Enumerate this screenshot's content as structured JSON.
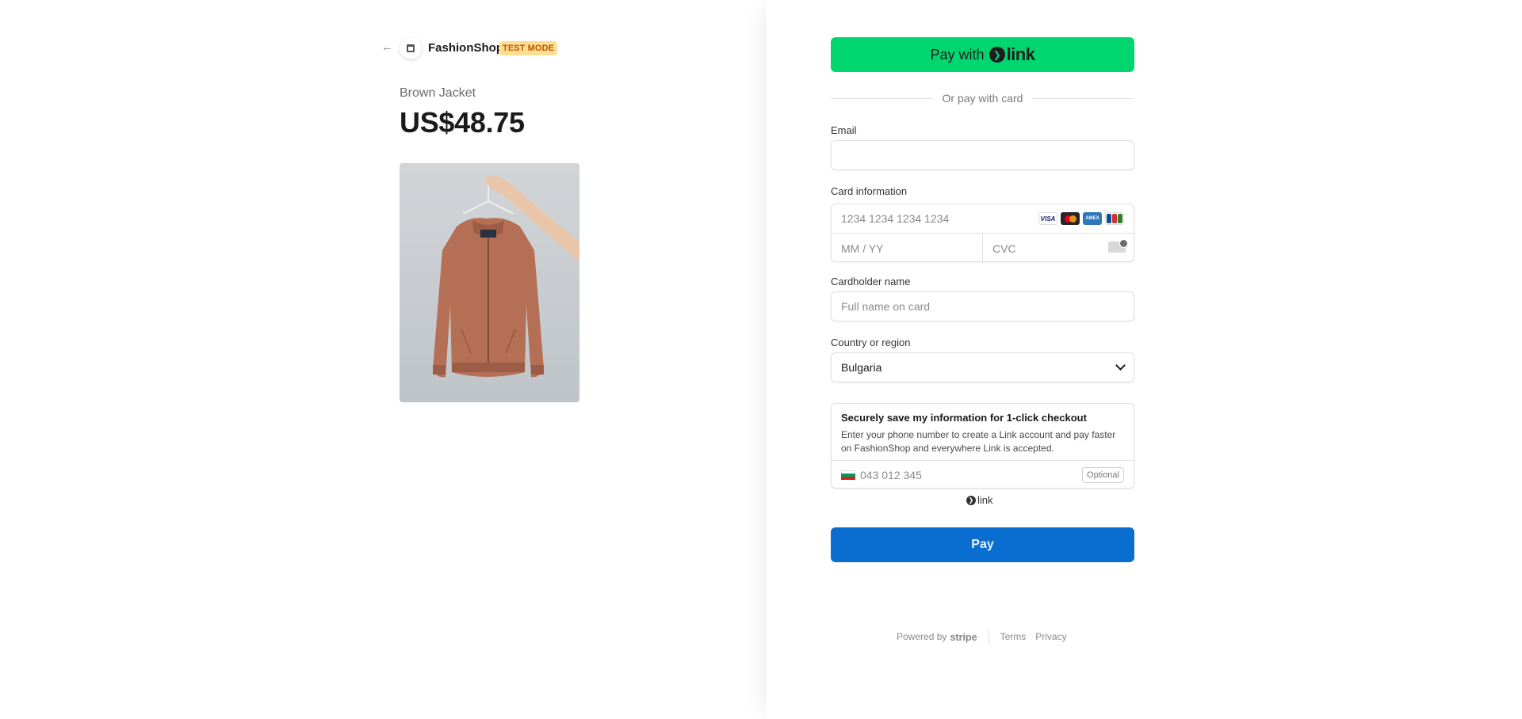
{
  "merchant": {
    "name": "FashionShop",
    "badge": "TEST MODE"
  },
  "product": {
    "name": "Brown Jacket",
    "price": "US$48.75"
  },
  "form": {
    "link_button_prefix": "Pay with",
    "link_logo_text": "link",
    "divider_text": "Or pay with card",
    "email": {
      "label": "Email",
      "value": ""
    },
    "card": {
      "label": "Card information",
      "number_placeholder": "1234 1234 1234 1234",
      "expiry_placeholder": "MM / YY",
      "cvc_placeholder": "CVC",
      "brands": [
        "VISA",
        "MasterCard",
        "AMEX",
        "JCB"
      ]
    },
    "cardholder": {
      "label": "Cardholder name",
      "placeholder": "Full name on card"
    },
    "country": {
      "label": "Country or region",
      "value": "Bulgaria"
    },
    "save": {
      "title": "Securely save my information for 1-click checkout",
      "description": "Enter your phone number to create a Link account and pay faster on FashionShop and everywhere Link is accepted.",
      "phone_placeholder": "043 012 345",
      "optional": "Optional"
    },
    "link_small": "link",
    "pay_label": "Pay"
  },
  "footer": {
    "powered_by": "Powered by",
    "brand": "stripe",
    "terms": "Terms",
    "privacy": "Privacy"
  },
  "colors": {
    "link_green": "#00d66f",
    "pay_blue": "#0a6ed1",
    "badge_bg": "#ffde92",
    "badge_text": "#bb5504"
  }
}
